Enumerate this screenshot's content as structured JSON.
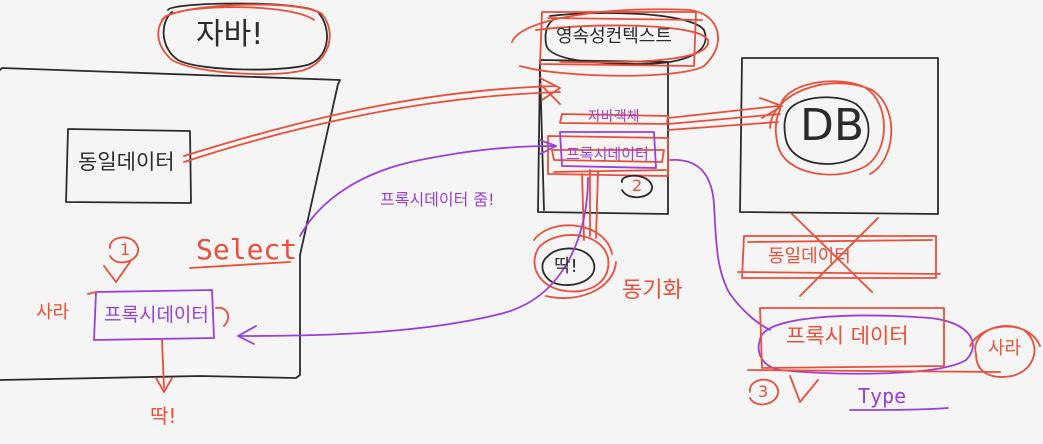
{
  "labels": {
    "jaban": "자바!",
    "persistence_context": "영속성컨텍스트",
    "db": "DB",
    "same_data_left": "동일데이터",
    "java_object": "자바객체",
    "proxy_data_ctx": "프록시데이터",
    "circle_2": "2",
    "proxy_given": "프록시데이터 줌!",
    "select": "Select",
    "circle_1": "1",
    "proxy_data_left": "프록시데이터",
    "real": "사라",
    "ttak": "딱!",
    "sync": "동기화",
    "same_data_right": "동일데이터",
    "proxy_data_right": "프록시 데이터",
    "real_right": "사라",
    "circle_3": "3",
    "checkmark": "V",
    "type": "Type",
    "ttak_bottom": "딱!"
  },
  "colors": {
    "ink": "#2b2b2b",
    "red": "#ea4f3a",
    "purple": "#9a3fd8",
    "background": "#f5f5f5"
  }
}
